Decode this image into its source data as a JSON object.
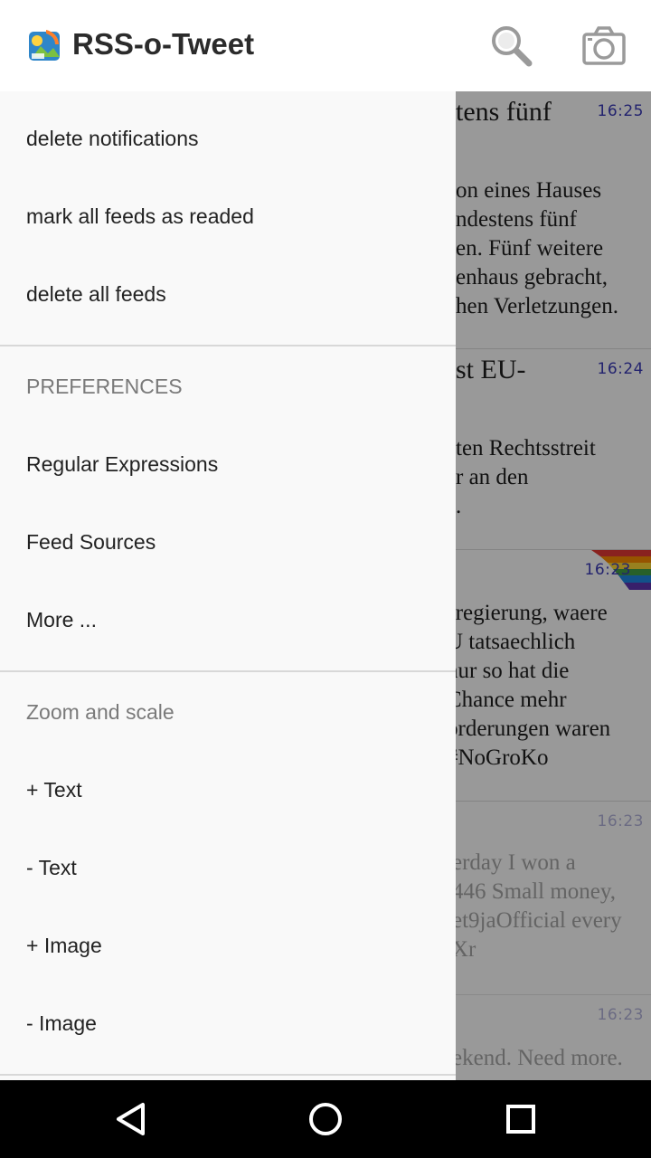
{
  "app": {
    "title": "RSS-o-Tweet",
    "logo_icon": "app-logo-icon"
  },
  "toolbar": {
    "search_icon": "search-icon",
    "camera_icon": "camera-icon"
  },
  "drawer": {
    "actions": [
      "delete notifications",
      "mark all feeds as readed",
      "delete all feeds"
    ],
    "preferences_header": "PREFERENCES",
    "preferences": [
      "Regular Expressions",
      "Feed Sources",
      "More ..."
    ],
    "zoom_header": "Zoom and scale",
    "zoom": [
      "+ Text",
      "- Text",
      "+ Image",
      "- Image"
    ]
  },
  "feed": {
    "items": [
      {
        "title": "tens fünf",
        "time": "16:25",
        "body": "on eines Hauses\nndestens fünf\nen. Fünf weitere\nenhaus gebracht,\nhen Verletzungen."
      },
      {
        "title": "st EU-",
        "time": "16:24",
        "body": "ten Rechtsstreit\nr an den\n."
      },
      {
        "title": "",
        "time": "16:23",
        "body": "sregierung, waere\nU tatsaechlich\nnur so hat die\nChance mehr\norderungen waren\n#NoGroKo"
      },
      {
        "title": "",
        "time": "16:23",
        "body": "erday I won a\n446 Small money,\net9jaOfficial every\nXr"
      },
      {
        "title": "",
        "time": "16:23",
        "body": "ekend. Need more."
      }
    ]
  },
  "navbar": {
    "back_icon": "back-triangle-icon",
    "home_icon": "home-circle-icon",
    "recents_icon": "recents-square-icon"
  },
  "colors": {
    "timestamp": "#3a3ab8",
    "drawer_bg": "#f9f9f9",
    "header_text": "#7a7a7a"
  }
}
